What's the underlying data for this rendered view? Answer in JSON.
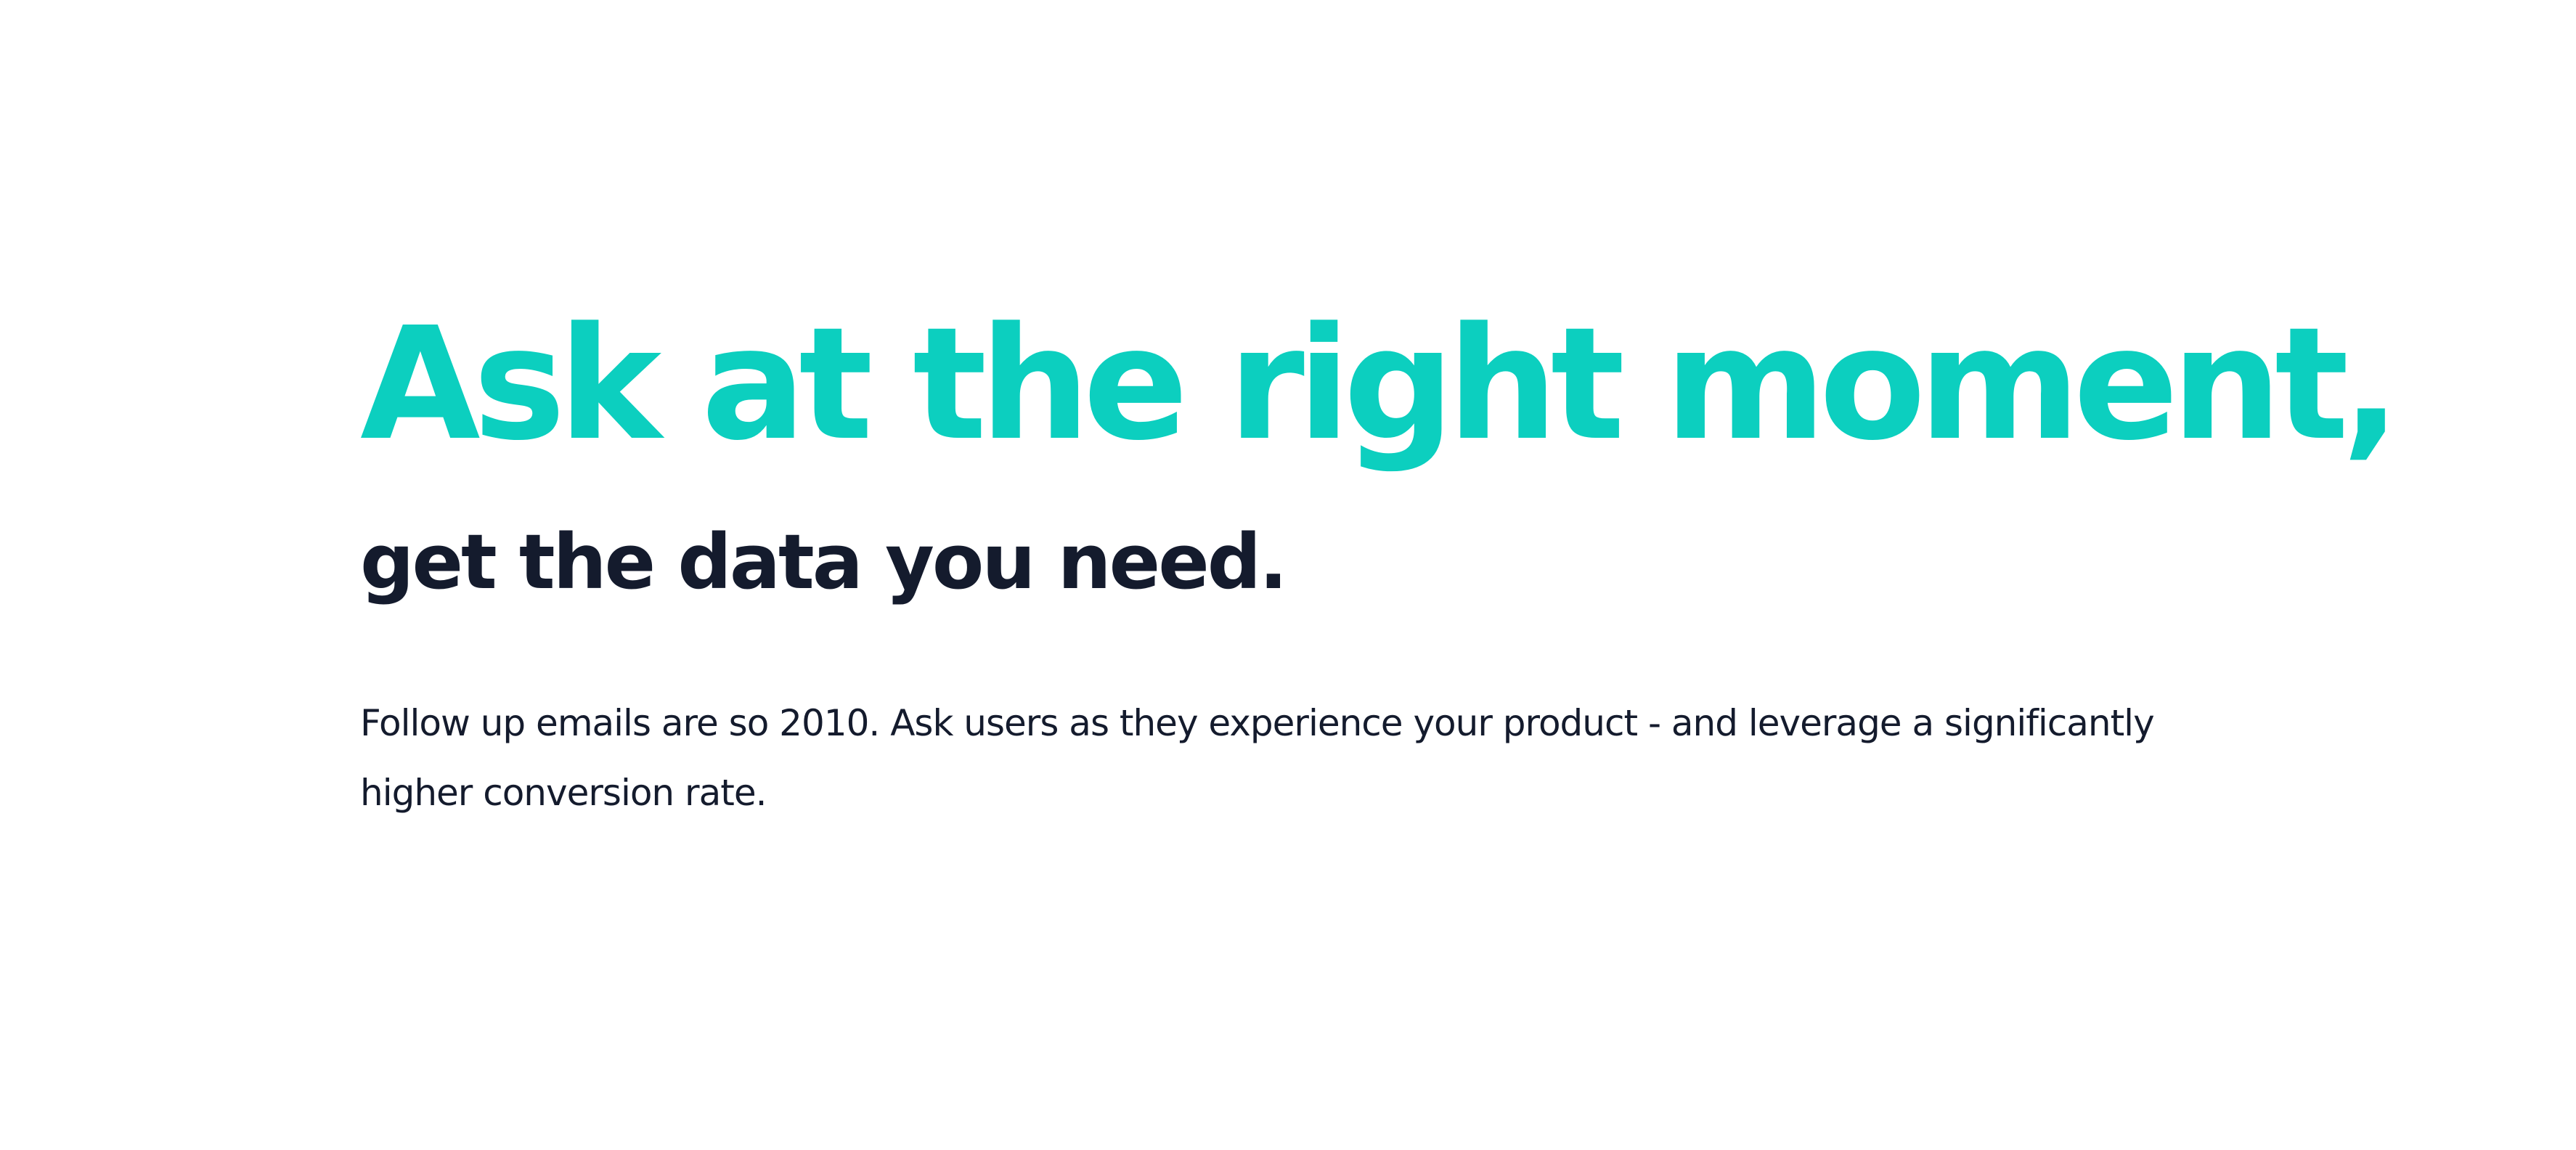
{
  "hero": {
    "headline": "Ask at the right moment,",
    "subheadline": "get the data you need.",
    "body": "Follow up emails are so 2010. Ask users as they experience your product - and leverage a significantly higher conversion rate."
  },
  "colors": {
    "accent": "#0ccfbf",
    "dark_text": "#141b2d",
    "background": "#ffffff"
  }
}
